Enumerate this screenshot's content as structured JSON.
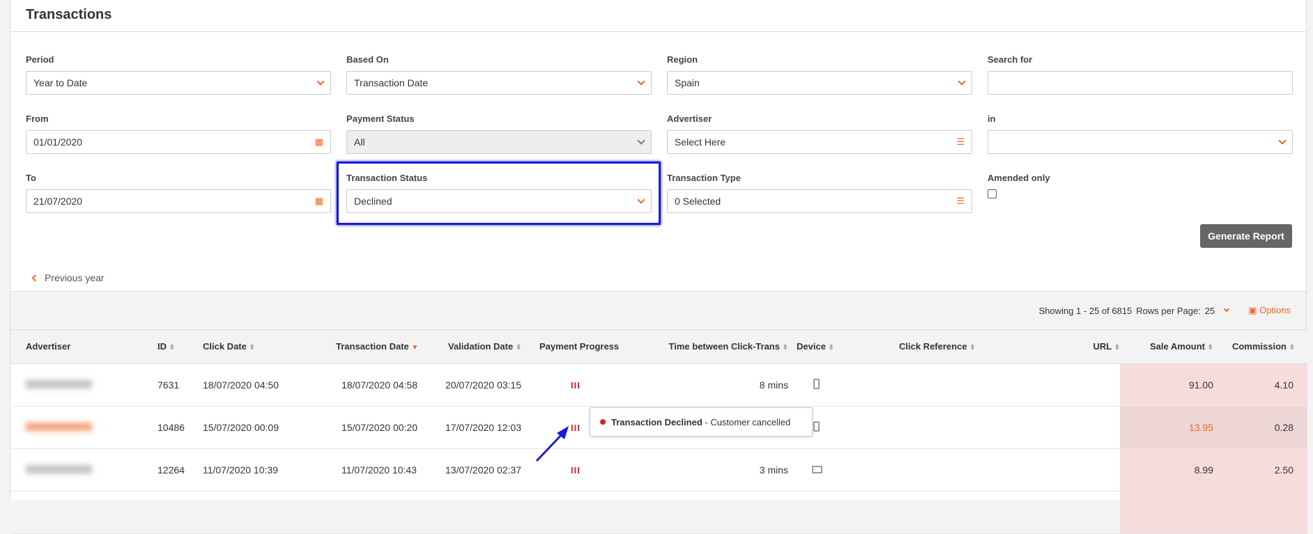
{
  "title": "Transactions",
  "filters": {
    "period": {
      "label": "Period",
      "value": "Year to Date"
    },
    "based_on": {
      "label": "Based On",
      "value": "Transaction Date"
    },
    "region": {
      "label": "Region",
      "value": "Spain"
    },
    "search": {
      "label": "Search for",
      "value": ""
    },
    "from": {
      "label": "From",
      "value": "01/01/2020"
    },
    "payment_status": {
      "label": "Payment Status",
      "value": "All"
    },
    "advertiser": {
      "label": "Advertiser",
      "value": "Select Here"
    },
    "in": {
      "label": "in",
      "value": ""
    },
    "to": {
      "label": "To",
      "value": "21/07/2020"
    },
    "transaction_status": {
      "label": "Transaction Status",
      "value": "Declined"
    },
    "transaction_type": {
      "label": "Transaction Type",
      "value": "0 Selected"
    },
    "amended": {
      "label": "Amended only",
      "checked": false
    }
  },
  "generate_label": "Generate Report",
  "previous_year": "Previous year",
  "toolbar": {
    "showing": "Showing 1 - 25 of 6815",
    "rows_label": "Rows per Page:",
    "rows_value": "25",
    "options": "Options"
  },
  "columns": [
    "Advertiser",
    "ID",
    "Click Date",
    "Transaction Date",
    "Validation Date",
    "Payment Progress",
    "Time between Click-Trans",
    "Device",
    "Click Reference",
    "URL",
    "Sale Amount",
    "Commission"
  ],
  "rows": [
    {
      "id": "7631",
      "click": "18/07/2020 04:50",
      "trans": "18/07/2020 04:58",
      "valid": "20/07/2020 03:15",
      "progress": "III",
      "time": "8 mins",
      "device": "mobile",
      "sale": "91.00",
      "commission": "4.10"
    },
    {
      "id": "10486",
      "click": "15/07/2020 00:09",
      "trans": "15/07/2020 00:20",
      "valid": "17/07/2020 12:03",
      "progress": "III",
      "time": "",
      "device": "mobile",
      "sale": "13.95",
      "commission": "0.28"
    },
    {
      "id": "12264",
      "click": "11/07/2020 10:39",
      "trans": "11/07/2020 10:43",
      "valid": "13/07/2020 02:37",
      "progress": "III",
      "time": "3 mins",
      "device": "desktop",
      "sale": "8.99",
      "commission": "2.50"
    }
  ],
  "tooltip": {
    "title": "Transaction Declined",
    "detail": " - Customer cancelled"
  },
  "colors": {
    "accent": "#f26522",
    "declined": "#dd2222",
    "highlight": "#1a1adb"
  }
}
